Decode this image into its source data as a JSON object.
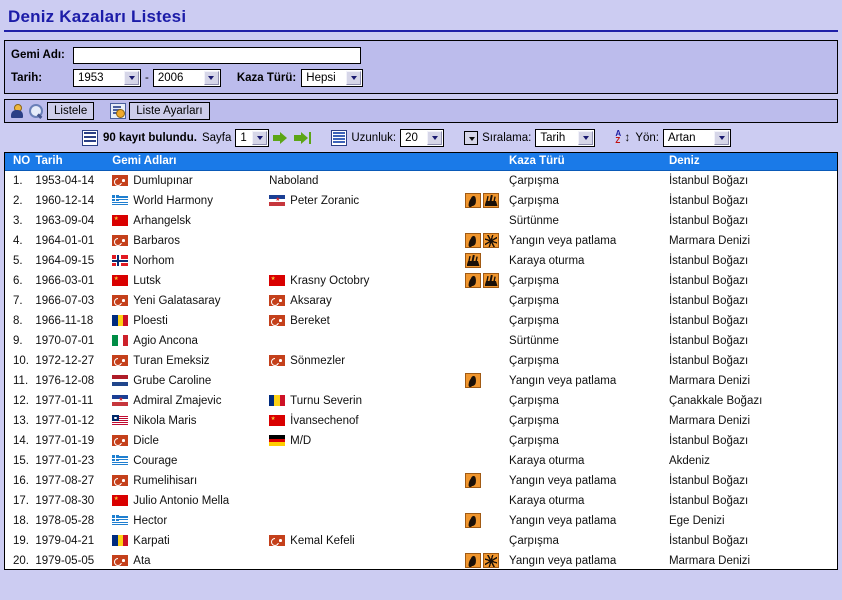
{
  "page": {
    "title": "Deniz Kazaları Listesi",
    "accent_blue": "#1a1ca8",
    "header_row_bg": "#1a7ae8",
    "panel_bg": "#bcbcec",
    "page_bg": "#ccccf2"
  },
  "search": {
    "ship_label": "Gemi Adı:",
    "ship_value": "",
    "ship_placeholder": "",
    "date_label": "Tarih:",
    "year_from": "1953",
    "year_to": "2006",
    "dash": "-",
    "accident_label": "Kaza Türü:",
    "accident_value": "Hepsi"
  },
  "toolbar": {
    "list_button": "Listele",
    "settings_button": "Liste Ayarları"
  },
  "pagebar": {
    "record_count": "90 kayıt bulundu.",
    "page_label": "Sayfa",
    "page_value": "1",
    "length_label": "Uzunluk:",
    "length_value": "20",
    "sort_label": "Sıralama:",
    "sort_value": "Tarih",
    "direction_label": "Yön:",
    "direction_value": "Artan"
  },
  "table": {
    "columns": [
      "NO",
      "Tarih",
      "Gemi Adları",
      "",
      "",
      "Kaza Türü",
      "Deniz"
    ],
    "rows": [
      {
        "no": "1.",
        "date": "1953-04-14",
        "ship1": "Dumlupınar",
        "flag1": "f-tr",
        "ship2": "Naboland",
        "flag2": "",
        "icons": [],
        "type": "Çarpışma",
        "sea": "İstanbul Boğazı"
      },
      {
        "no": "2.",
        "date": "1960-12-14",
        "ship1": "World Harmony",
        "flag1": "f-gr",
        "ship2": "Peter Zoranic",
        "flag2": "f-yu",
        "icons": [
          "fire",
          "wreck"
        ],
        "type": "Çarpışma",
        "sea": "İstanbul Boğazı"
      },
      {
        "no": "3.",
        "date": "1963-09-04",
        "ship1": "Arhangelsk",
        "flag1": "f-su",
        "ship2": "",
        "flag2": "",
        "icons": [],
        "type": "Sürtünme",
        "sea": "İstanbul Boğazı"
      },
      {
        "no": "4.",
        "date": "1964-01-01",
        "ship1": "Barbaros",
        "flag1": "f-tr",
        "ship2": "",
        "flag2": "",
        "icons": [
          "fire",
          "blast"
        ],
        "type": "Yangın veya patlama",
        "sea": "Marmara Denizi"
      },
      {
        "no": "5.",
        "date": "1964-09-15",
        "ship1": "Norhom",
        "flag1": "f-no",
        "ship2": "",
        "flag2": "",
        "icons": [
          "wreck"
        ],
        "type": "Karaya oturma",
        "sea": "İstanbul Boğazı"
      },
      {
        "no": "6.",
        "date": "1966-03-01",
        "ship1": "Lutsk",
        "flag1": "f-su",
        "ship2": "Krasny Octobry",
        "flag2": "f-su",
        "icons": [
          "fire",
          "wreck"
        ],
        "type": "Çarpışma",
        "sea": "İstanbul Boğazı"
      },
      {
        "no": "7.",
        "date": "1966-07-03",
        "ship1": "Yeni Galatasaray",
        "flag1": "f-tr",
        "ship2": "Aksaray",
        "flag2": "f-tr",
        "icons": [],
        "type": "Çarpışma",
        "sea": "İstanbul Boğazı"
      },
      {
        "no": "8.",
        "date": "1966-11-18",
        "ship1": "Ploesti",
        "flag1": "f-ro",
        "ship2": "Bereket",
        "flag2": "f-tr",
        "icons": [],
        "type": "Çarpışma",
        "sea": "İstanbul Boğazı"
      },
      {
        "no": "9.",
        "date": "1970-07-01",
        "ship1": "Agio Ancona",
        "flag1": "f-it",
        "ship2": "",
        "flag2": "",
        "icons": [],
        "type": "Sürtünme",
        "sea": "İstanbul Boğazı"
      },
      {
        "no": "10.",
        "date": "1972-12-27",
        "ship1": "Turan Emeksiz",
        "flag1": "f-tr",
        "ship2": "Sönmezler",
        "flag2": "f-tr",
        "icons": [],
        "type": "Çarpışma",
        "sea": "İstanbul Boğazı"
      },
      {
        "no": "11.",
        "date": "1976-12-08",
        "ship1": "Grube Caroline",
        "flag1": "f-nl",
        "ship2": "",
        "flag2": "",
        "icons": [
          "fire"
        ],
        "type": "Yangın veya patlama",
        "sea": "Marmara Denizi"
      },
      {
        "no": "12.",
        "date": "1977-01-11",
        "ship1": "Admiral Zmajevic",
        "flag1": "f-yu",
        "ship2": "Turnu Severin",
        "flag2": "f-ro",
        "icons": [],
        "type": "Çarpışma",
        "sea": "Çanakkale Boğazı"
      },
      {
        "no": "13.",
        "date": "1977-01-12",
        "ship1": "Nikola Maris",
        "flag1": "f-lr",
        "ship2": "İvansechenof",
        "flag2": "f-su",
        "icons": [],
        "type": "Çarpışma",
        "sea": "Marmara Denizi"
      },
      {
        "no": "14.",
        "date": "1977-01-19",
        "ship1": "Dicle",
        "flag1": "f-tr",
        "ship2": "M/D",
        "flag2": "f-de",
        "icons": [],
        "type": "Çarpışma",
        "sea": "İstanbul Boğazı"
      },
      {
        "no": "15.",
        "date": "1977-01-23",
        "ship1": "Courage",
        "flag1": "f-gr",
        "ship2": "",
        "flag2": "",
        "icons": [],
        "type": "Karaya oturma",
        "sea": "Akdeniz"
      },
      {
        "no": "16.",
        "date": "1977-08-27",
        "ship1": "Rumelihisarı",
        "flag1": "f-tr",
        "ship2": "",
        "flag2": "",
        "icons": [
          "fire"
        ],
        "type": "Yangın veya patlama",
        "sea": "İstanbul Boğazı"
      },
      {
        "no": "17.",
        "date": "1977-08-30",
        "ship1": "Julio Antonio Mella",
        "flag1": "f-su",
        "ship2": "",
        "flag2": "",
        "icons": [],
        "type": "Karaya oturma",
        "sea": "İstanbul Boğazı"
      },
      {
        "no": "18.",
        "date": "1978-05-28",
        "ship1": "Hector",
        "flag1": "f-gr",
        "ship2": "",
        "flag2": "",
        "icons": [
          "fire"
        ],
        "type": "Yangın veya patlama",
        "sea": "Ege Denizi"
      },
      {
        "no": "19.",
        "date": "1979-04-21",
        "ship1": "Karpati",
        "flag1": "f-ro",
        "ship2": "Kemal Kefeli",
        "flag2": "f-tr",
        "icons": [],
        "type": "Çarpışma",
        "sea": "İstanbul Boğazı"
      },
      {
        "no": "20.",
        "date": "1979-05-05",
        "ship1": "Ata",
        "flag1": "f-tr",
        "ship2": "",
        "flag2": "",
        "icons": [
          "fire",
          "blast"
        ],
        "type": "Yangın veya patlama",
        "sea": "Marmara Denizi"
      }
    ]
  }
}
